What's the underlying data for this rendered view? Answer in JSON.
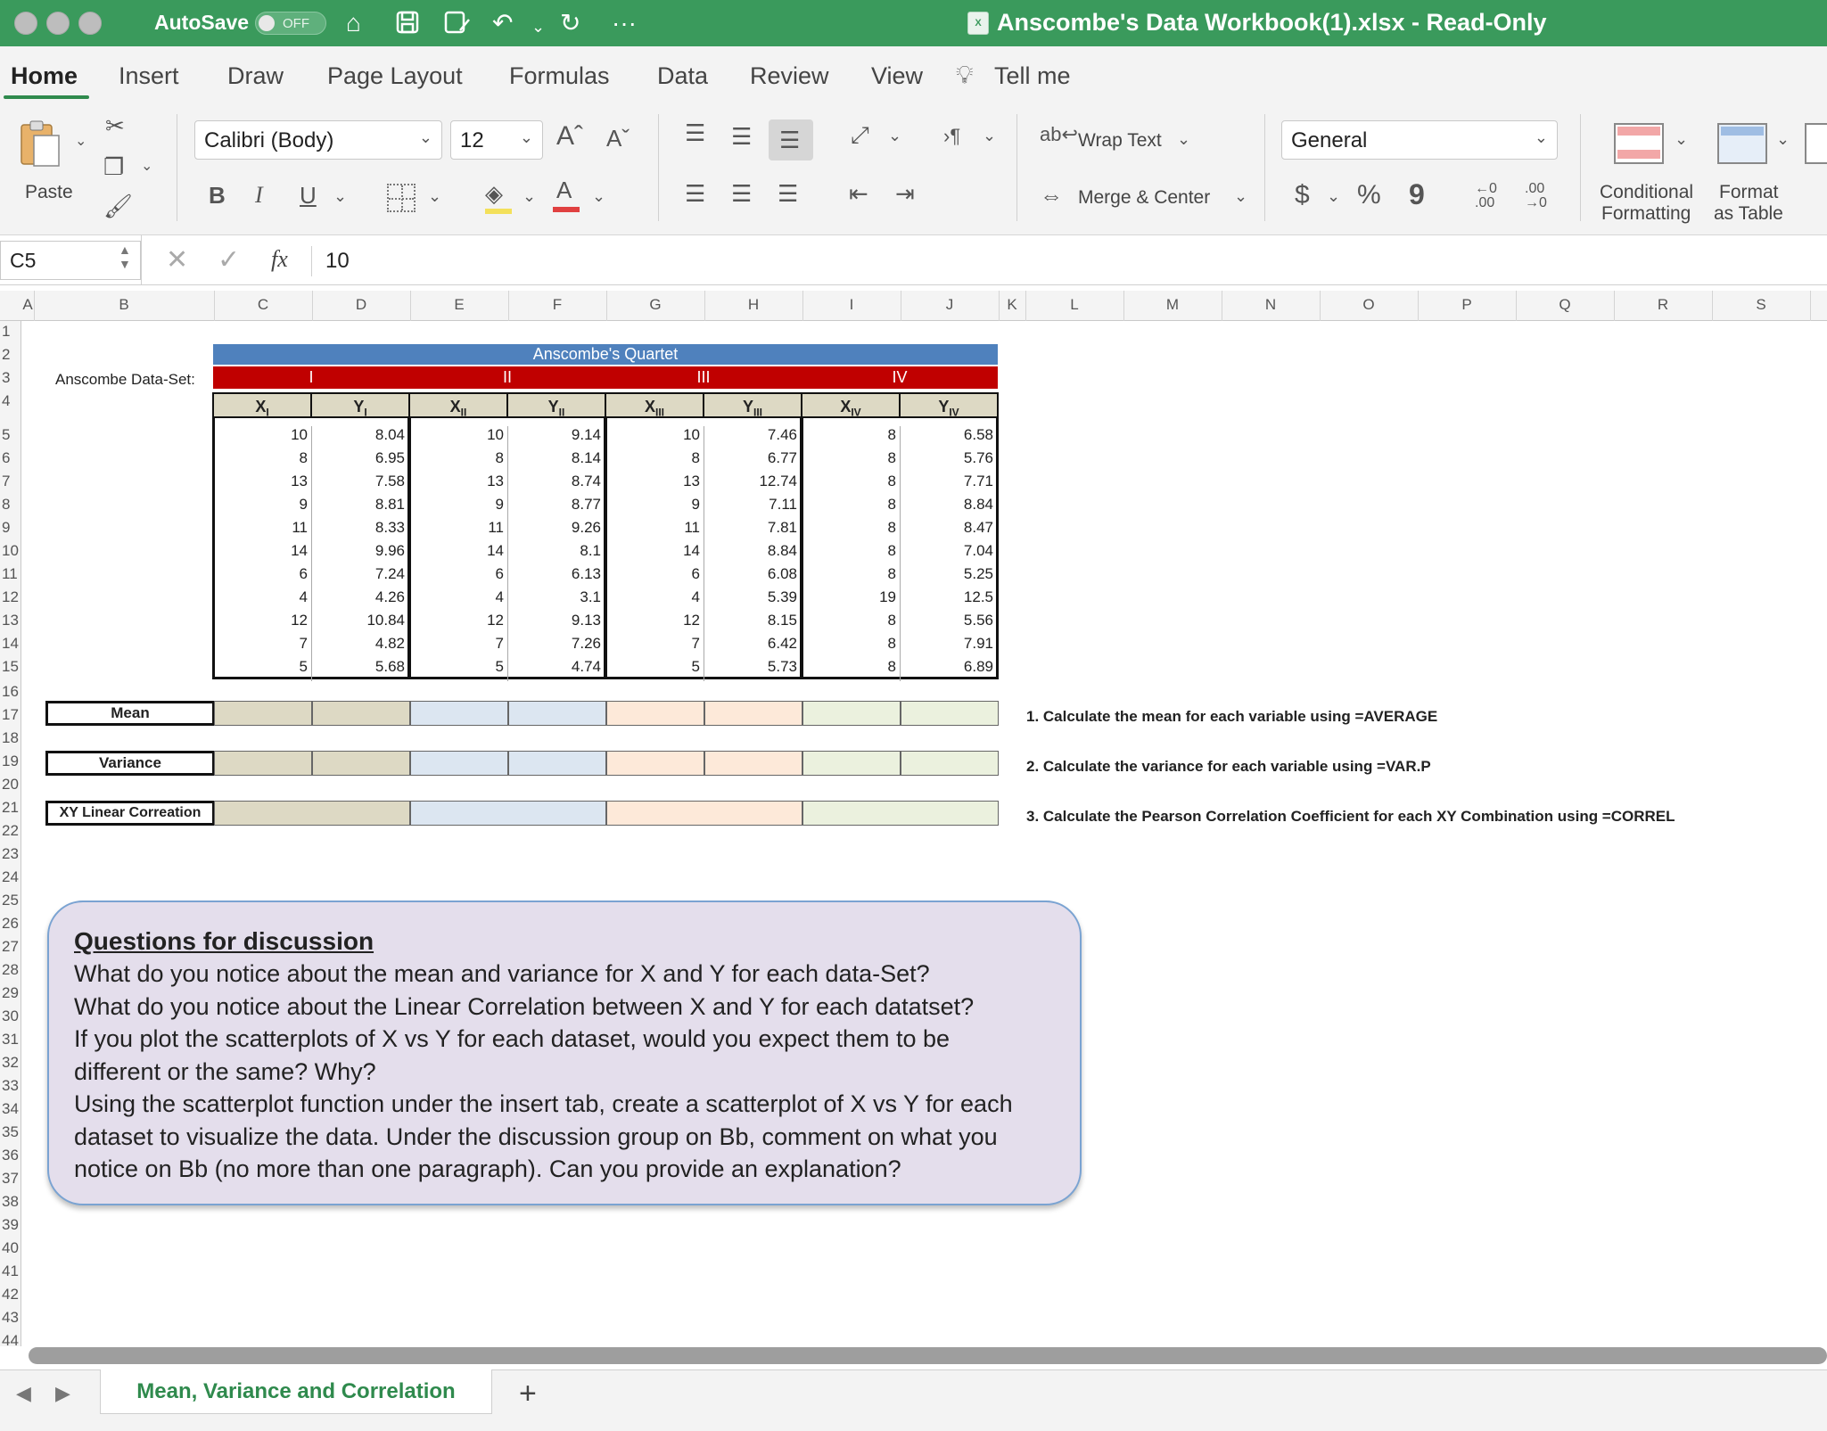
{
  "titlebar": {
    "autosave_label": "AutoSave",
    "autosave_state": "OFF",
    "doc_title": "Anscombe's Data Workbook(1).xlsx  -  Read-Only",
    "more": "···"
  },
  "tabs": [
    "Home",
    "Insert",
    "Draw",
    "Page Layout",
    "Formulas",
    "Data",
    "Review",
    "View",
    "Tell me"
  ],
  "ribbon": {
    "paste_label": "Paste",
    "font_name": "Calibri (Body)",
    "font_size": "12",
    "bold": "B",
    "italic": "I",
    "underline": "U",
    "wrap_text": "Wrap Text",
    "merge_center": "Merge & Center",
    "number_format": "General",
    "currency": "$",
    "percent": "%",
    "comma": "9",
    "conditional_formatting": [
      "Conditional",
      "Formatting"
    ],
    "format_as_table": [
      "Format",
      "as Table"
    ]
  },
  "formula_bar": {
    "name_box": "C5",
    "fx": "fx",
    "value": "10"
  },
  "columns": [
    "A",
    "B",
    "C",
    "D",
    "E",
    "F",
    "G",
    "H",
    "I",
    "J",
    "K",
    "L",
    "M",
    "N",
    "O",
    "P",
    "Q",
    "R",
    "S"
  ],
  "rows": [
    "1",
    "2",
    "3",
    "4",
    "5",
    "6",
    "7",
    "8",
    "9",
    "10",
    "11",
    "12",
    "13",
    "14",
    "15",
    "16",
    "17",
    "18",
    "19",
    "20",
    "21",
    "22",
    "23",
    "24",
    "25",
    "26",
    "27",
    "28",
    "29",
    "30",
    "31",
    "32",
    "33",
    "34",
    "35",
    "36",
    "37",
    "38",
    "39",
    "40",
    "41",
    "42",
    "43",
    "44"
  ],
  "sheet": {
    "dataset_label": "Anscombe Data-Set:",
    "quartet_title": "Anscombe's Quartet",
    "sets": [
      "I",
      "II",
      "III",
      "IV"
    ],
    "var_headers": [
      {
        "base": "X",
        "sub": "I"
      },
      {
        "base": "Y",
        "sub": "I"
      },
      {
        "base": "X",
        "sub": "II"
      },
      {
        "base": "Y",
        "sub": "II"
      },
      {
        "base": "X",
        "sub": "III"
      },
      {
        "base": "Y",
        "sub": "III"
      },
      {
        "base": "X",
        "sub": "IV"
      },
      {
        "base": "Y",
        "sub": "IV"
      }
    ],
    "data": [
      [
        "10",
        "8.04",
        "10",
        "9.14",
        "10",
        "7.46",
        "8",
        "6.58"
      ],
      [
        "8",
        "6.95",
        "8",
        "8.14",
        "8",
        "6.77",
        "8",
        "5.76"
      ],
      [
        "13",
        "7.58",
        "13",
        "8.74",
        "13",
        "12.74",
        "8",
        "7.71"
      ],
      [
        "9",
        "8.81",
        "9",
        "8.77",
        "9",
        "7.11",
        "8",
        "8.84"
      ],
      [
        "11",
        "8.33",
        "11",
        "9.26",
        "11",
        "7.81",
        "8",
        "8.47"
      ],
      [
        "14",
        "9.96",
        "14",
        "8.1",
        "14",
        "8.84",
        "8",
        "7.04"
      ],
      [
        "6",
        "7.24",
        "6",
        "6.13",
        "6",
        "6.08",
        "8",
        "5.25"
      ],
      [
        "4",
        "4.26",
        "4",
        "3.1",
        "4",
        "5.39",
        "19",
        "12.5"
      ],
      [
        "12",
        "10.84",
        "12",
        "9.13",
        "12",
        "8.15",
        "8",
        "5.56"
      ],
      [
        "7",
        "4.82",
        "7",
        "7.26",
        "7",
        "6.42",
        "8",
        "7.91"
      ],
      [
        "5",
        "5.68",
        "5",
        "4.74",
        "5",
        "5.73",
        "8",
        "6.89"
      ]
    ],
    "mean_label": "Mean",
    "variance_label": "Variance",
    "correlation_label": "XY Linear Correation",
    "instructions": [
      "1. Calculate the mean for each variable using =AVERAGE",
      "2. Calculate the variance for each variable using =VAR.P",
      "3. Calculate the Pearson Correlation Coefficient for each XY Combination using =CORREL"
    ],
    "questions_title": "Questions for discussion",
    "questions_lines": [
      "What do you notice about the mean and variance for X and Y for each data-Set?",
      "What do you notice about the Linear Correlation between X and Y for each datatset?",
      "If you plot the scatterplots of X vs Y for each dataset, would you expect them to be",
      "different or the same? Why?",
      "Using the scatterplot function under the insert tab, create a scatterplot of X vs Y for each",
      "dataset to visualize the data.  Under the discussion group on Bb, comment on what you",
      "notice on Bb (no more than one paragraph). Can you provide an explanation?"
    ]
  },
  "sheet_tab": "Mean, Variance and Correlation",
  "add_sheet": "+",
  "colors": {
    "title_green": "#3a9a5c",
    "quartet_blue": "#4f81bd",
    "set_red": "#c00000",
    "set1_tan": "#ddd9c4",
    "set2_blue": "#dce6f1",
    "set3_peach": "#fde9d9",
    "set4_green": "#ebf1de",
    "discussion_bg": "#e4deec"
  }
}
